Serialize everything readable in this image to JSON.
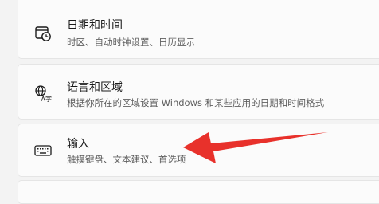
{
  "settings": {
    "items": [
      {
        "title": "日期和时间",
        "subtitle": "时区、自动时钟设置、日历显示",
        "icon": "calendar-clock-icon"
      },
      {
        "title": "语言和区域",
        "subtitle": "根据你所在的区域设置 Windows 和某些应用的日期和时间格式",
        "icon": "language-icon"
      },
      {
        "title": "输入",
        "subtitle": "触摸键盘、文本建议、首选项",
        "icon": "keyboard-icon"
      }
    ]
  },
  "annotation": {
    "arrow_color": "#e8312b"
  }
}
